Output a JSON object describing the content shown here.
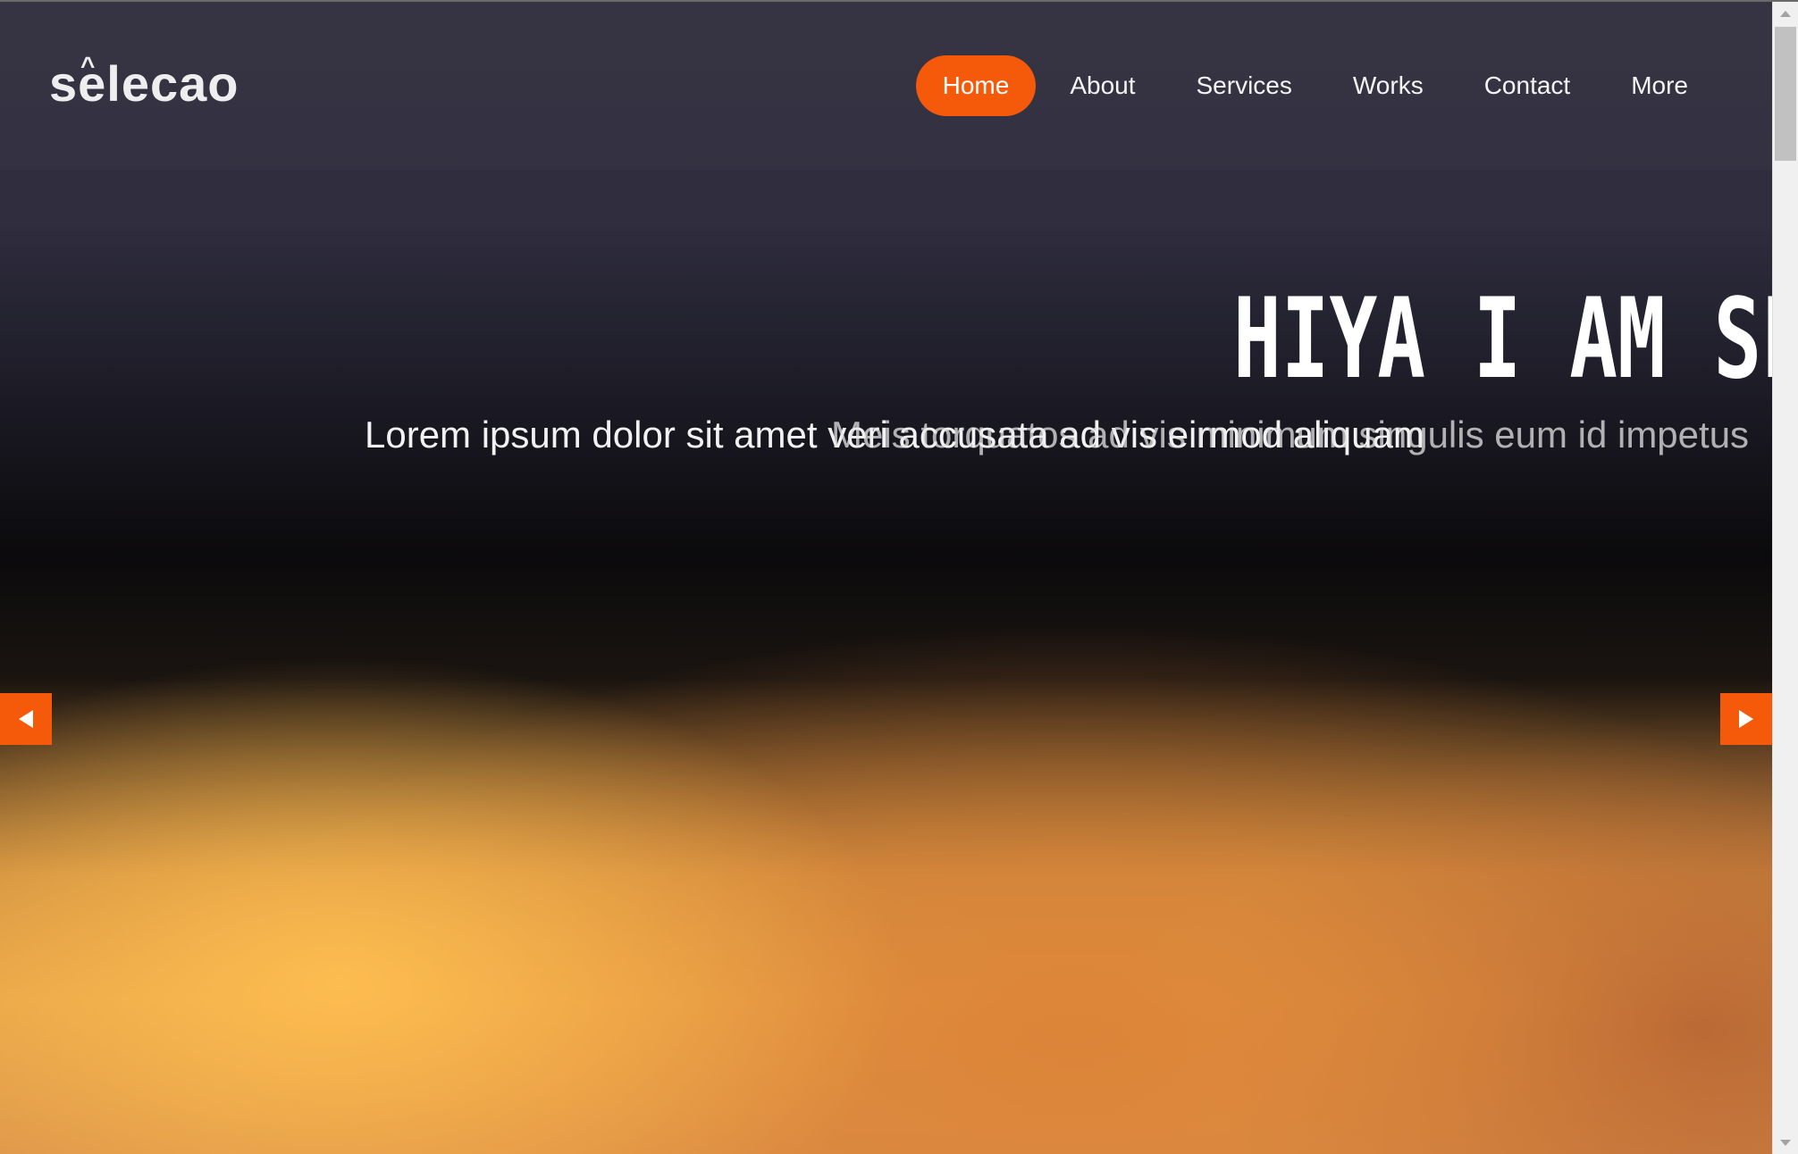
{
  "logo": {
    "text": "selecao",
    "hat": "^"
  },
  "nav": {
    "items": [
      {
        "label": "Home",
        "active": true
      },
      {
        "label": "About",
        "active": false
      },
      {
        "label": "Services",
        "active": false
      },
      {
        "label": "Works",
        "active": false
      },
      {
        "label": "Contact",
        "active": false
      },
      {
        "label": "More",
        "active": false
      }
    ]
  },
  "hero": {
    "title": "HIYA I AM SEL",
    "subtitle_1": "Lorem ipsum dolor sit amet veri accusata ad vis eirmod aliquam",
    "subtitle_2": "Meis torquatos ad vis minimum singulis eum id impetus"
  },
  "carousel": {
    "prev_icon": "arrow-left-icon",
    "next_icon": "arrow-right-icon"
  },
  "colors": {
    "accent": "#f45a0a",
    "text": "#ffffff"
  }
}
